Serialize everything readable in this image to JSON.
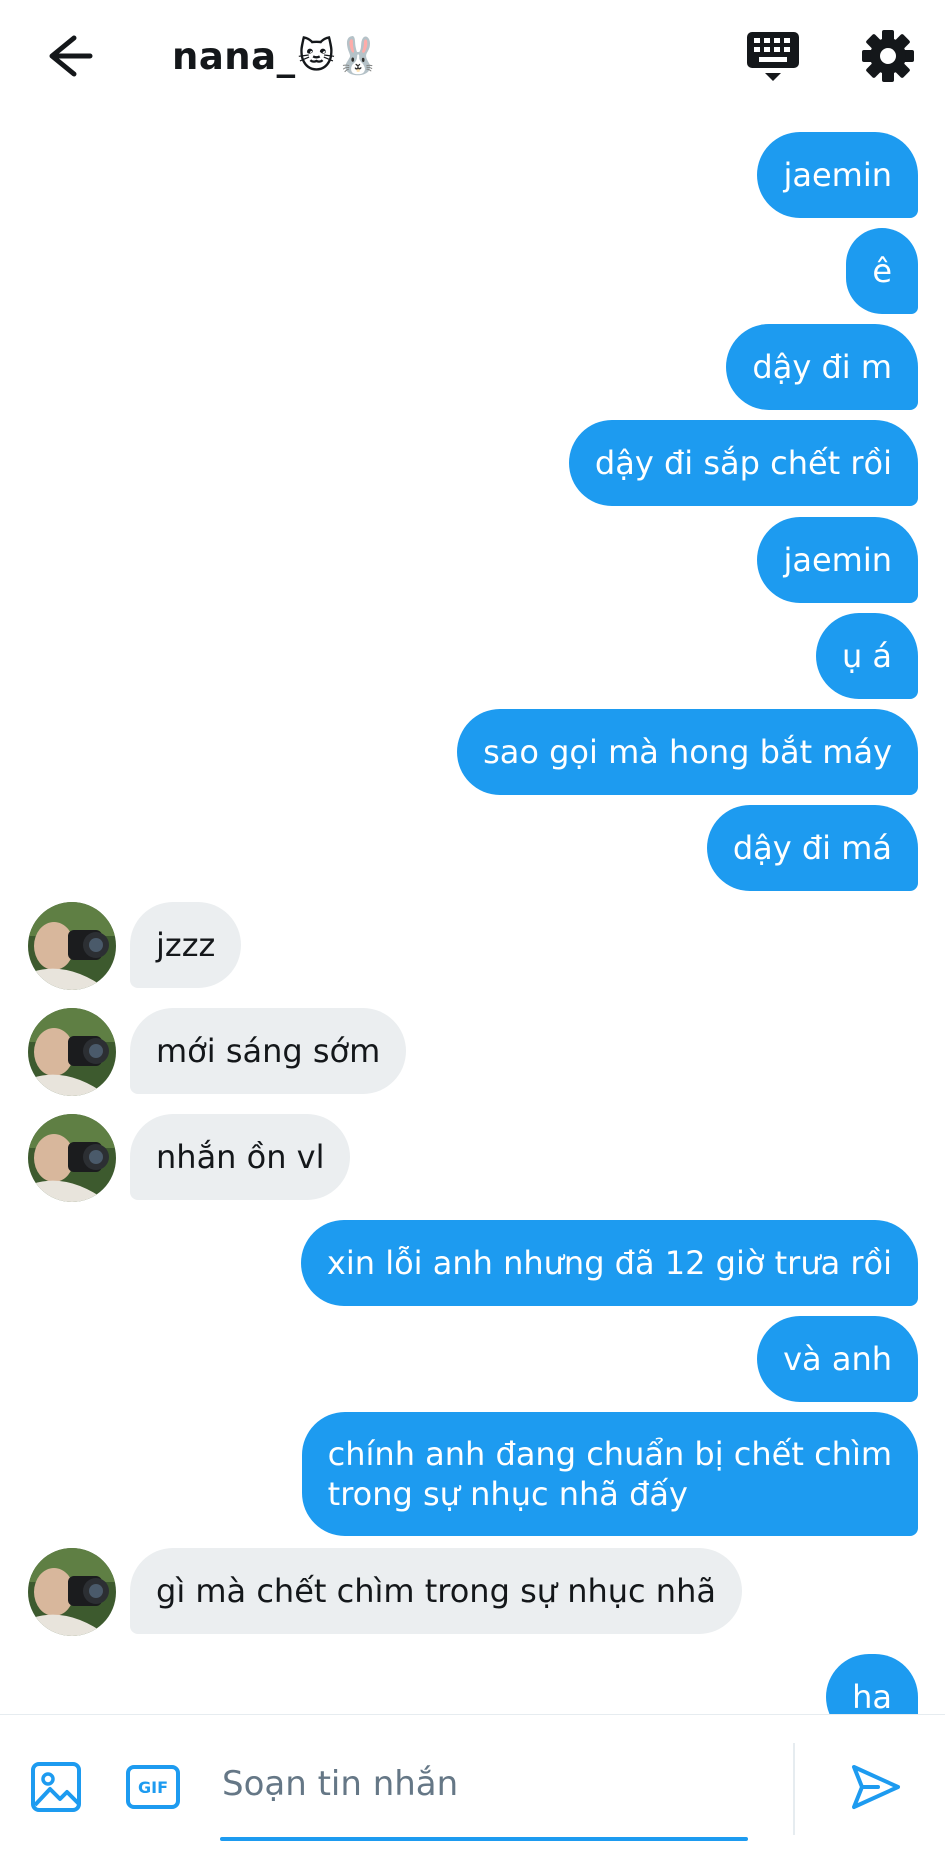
{
  "header": {
    "title": "nana_",
    "title_emoji": "🐱🐰",
    "back_icon": "back-arrow-icon",
    "keyboard_icon": "keyboard-icon",
    "settings_icon": "gear-icon"
  },
  "messages": [
    {
      "side": "sent",
      "text": "jaemin"
    },
    {
      "side": "sent",
      "text": "ê"
    },
    {
      "side": "sent",
      "text": "dậy đi m"
    },
    {
      "side": "sent",
      "text": "dậy đi sắp chết rồi"
    },
    {
      "side": "sent",
      "text": "jaemin"
    },
    {
      "side": "sent",
      "text": "ụ á"
    },
    {
      "side": "sent",
      "text": "sao gọi mà hong bắt máy"
    },
    {
      "side": "sent",
      "text": "dậy đi má"
    },
    {
      "side": "recv",
      "text": "jzzz"
    },
    {
      "side": "recv",
      "text": "mới sáng sớm"
    },
    {
      "side": "recv",
      "text": "nhắn ồn vl"
    },
    {
      "side": "sent",
      "text": "xin lỗi anh nhưng đã 12 giờ trưa rồi"
    },
    {
      "side": "sent",
      "text": "và anh"
    },
    {
      "side": "sent",
      "lines": [
        "chính anh đang chuẩn bị chết chìm",
        "trong sự nhục nhã đấy"
      ]
    },
    {
      "side": "recv",
      "text": "gì mà chết chìm trong sự nhục nhã"
    },
    {
      "side": "sent",
      "text": "ha"
    }
  ],
  "composer": {
    "placeholder": "Soạn tin nhắn",
    "value": "",
    "media_icon": "image-icon",
    "gif_label": "GIF",
    "send_icon": "send-icon"
  },
  "colors": {
    "accent": "#1d9bf0",
    "received_bubble": "#ebeef0",
    "text": "#14171a",
    "placeholder": "#657786"
  }
}
